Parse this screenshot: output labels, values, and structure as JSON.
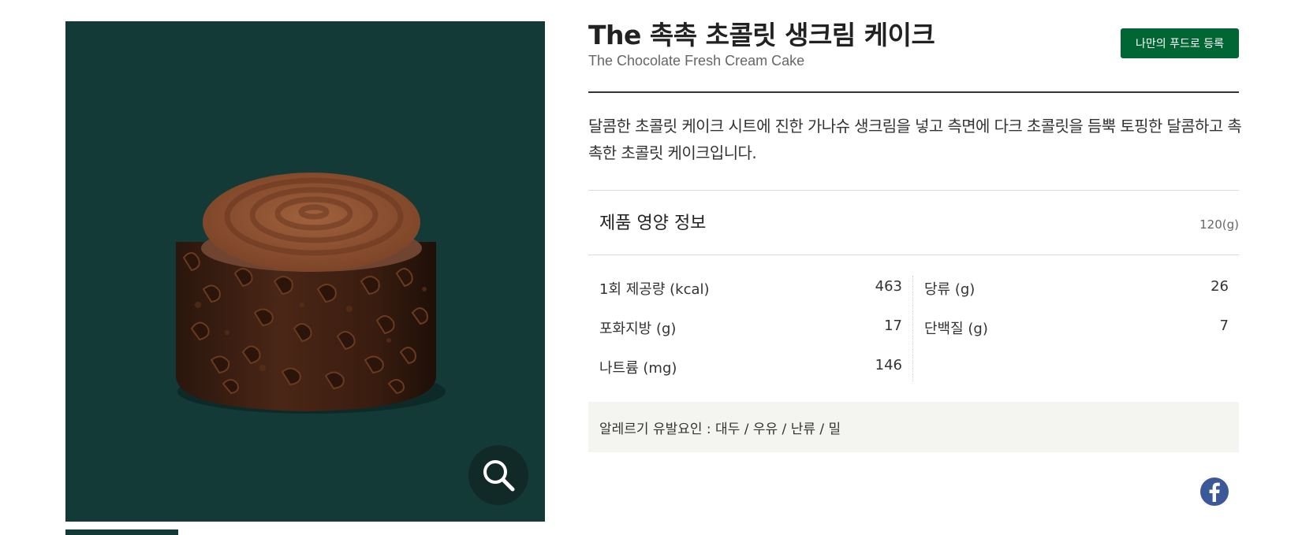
{
  "product": {
    "name_ko": "The 촉촉 초콜릿 생크림 케이크",
    "name_en": "The Chocolate Fresh Cream Cake",
    "register_button_label": "나만의 푸드로 등록",
    "description": "달콤한 초콜릿 케이크 시트에 진한 가나슈 생크림을 넣고 측면에 다크 초콜릿을 듬뿍 토핑한 달콤하고 촉촉한 초콜릿 케이크입니다."
  },
  "nutrition": {
    "title": "제품 영양 정보",
    "serving_size": "120(g)",
    "items": [
      {
        "label": "1회 제공량 (kcal)",
        "value": "463"
      },
      {
        "label": "당류 (g)",
        "value": "26"
      },
      {
        "label": "포화지방 (g)",
        "value": "17"
      },
      {
        "label": "단백질 (g)",
        "value": "7"
      },
      {
        "label": "나트륨 (mg)",
        "value": "146"
      }
    ]
  },
  "allergy": {
    "text": "알레르기 유발요인 : 대두 / 우유 / 난류 / 밀"
  },
  "colors": {
    "brand_green": "#006633",
    "image_background": "#133a37",
    "facebook_blue": "#3b5998"
  },
  "icons": {
    "zoom": "search-icon",
    "share": "facebook-icon"
  }
}
